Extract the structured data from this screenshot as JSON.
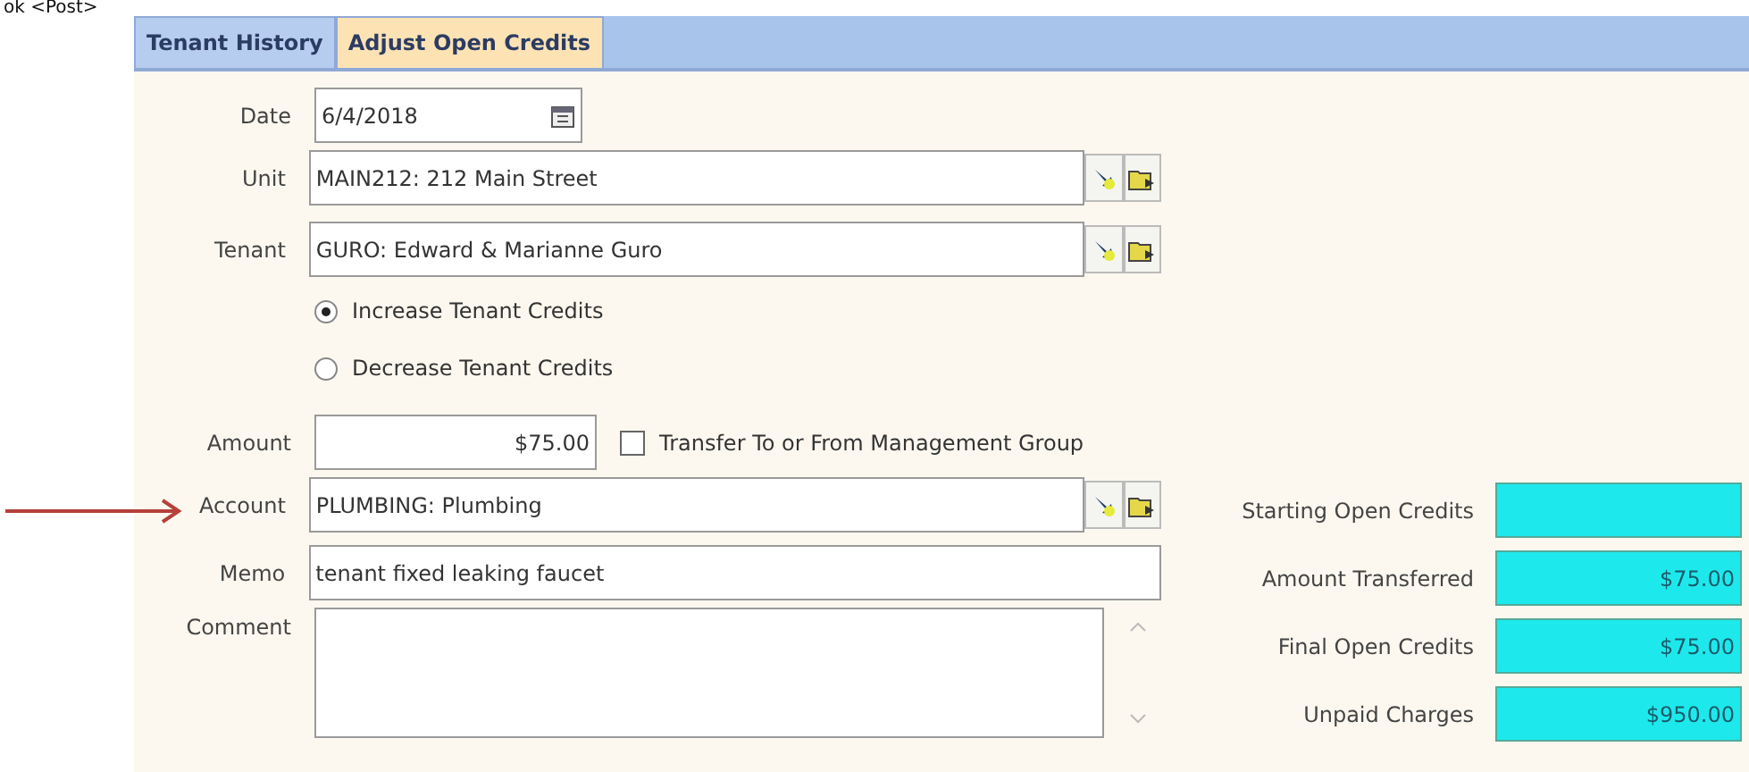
{
  "top_text": "ok <Post>",
  "tabs": [
    {
      "label": "Tenant History",
      "selected": false
    },
    {
      "label": "Adjust Open Credits",
      "selected": true
    }
  ],
  "rows": [
    {
      "kind": "date",
      "label": "Date",
      "value": "6/4/2018"
    },
    {
      "kind": "lookup",
      "label": "Unit",
      "value": "MAIN212: 212 Main Street"
    },
    {
      "kind": "lookup",
      "label": "Tenant",
      "value": "GURO: Edward & Marianne Guro"
    },
    {
      "kind": "options",
      "options": [
        {
          "label": "Increase Tenant Credits",
          "selected": true
        },
        {
          "label": "Decrease Tenant Credits",
          "selected": false
        }
      ]
    },
    {
      "kind": "amount",
      "label": "Amount",
      "value": "$75.00",
      "checkbox": {
        "label": "Transfer To or From Management Group",
        "checked": false
      }
    },
    {
      "kind": "lookup",
      "label": "Account",
      "value": "PLUMBING: Plumbing"
    },
    {
      "kind": "text",
      "label": "Memo",
      "value": "tenant fixed leaking faucet"
    },
    {
      "kind": "memo",
      "label": "Comment"
    }
  ],
  "totals": [
    {
      "label": "Starting Open Credits"
    },
    {
      "label": "Amount Transferred",
      "value": "$75.00"
    },
    {
      "label": "Final Open Credits",
      "value": "$75.00"
    },
    {
      "label": "Unpaid Charges",
      "value": "$950.00"
    }
  ]
}
